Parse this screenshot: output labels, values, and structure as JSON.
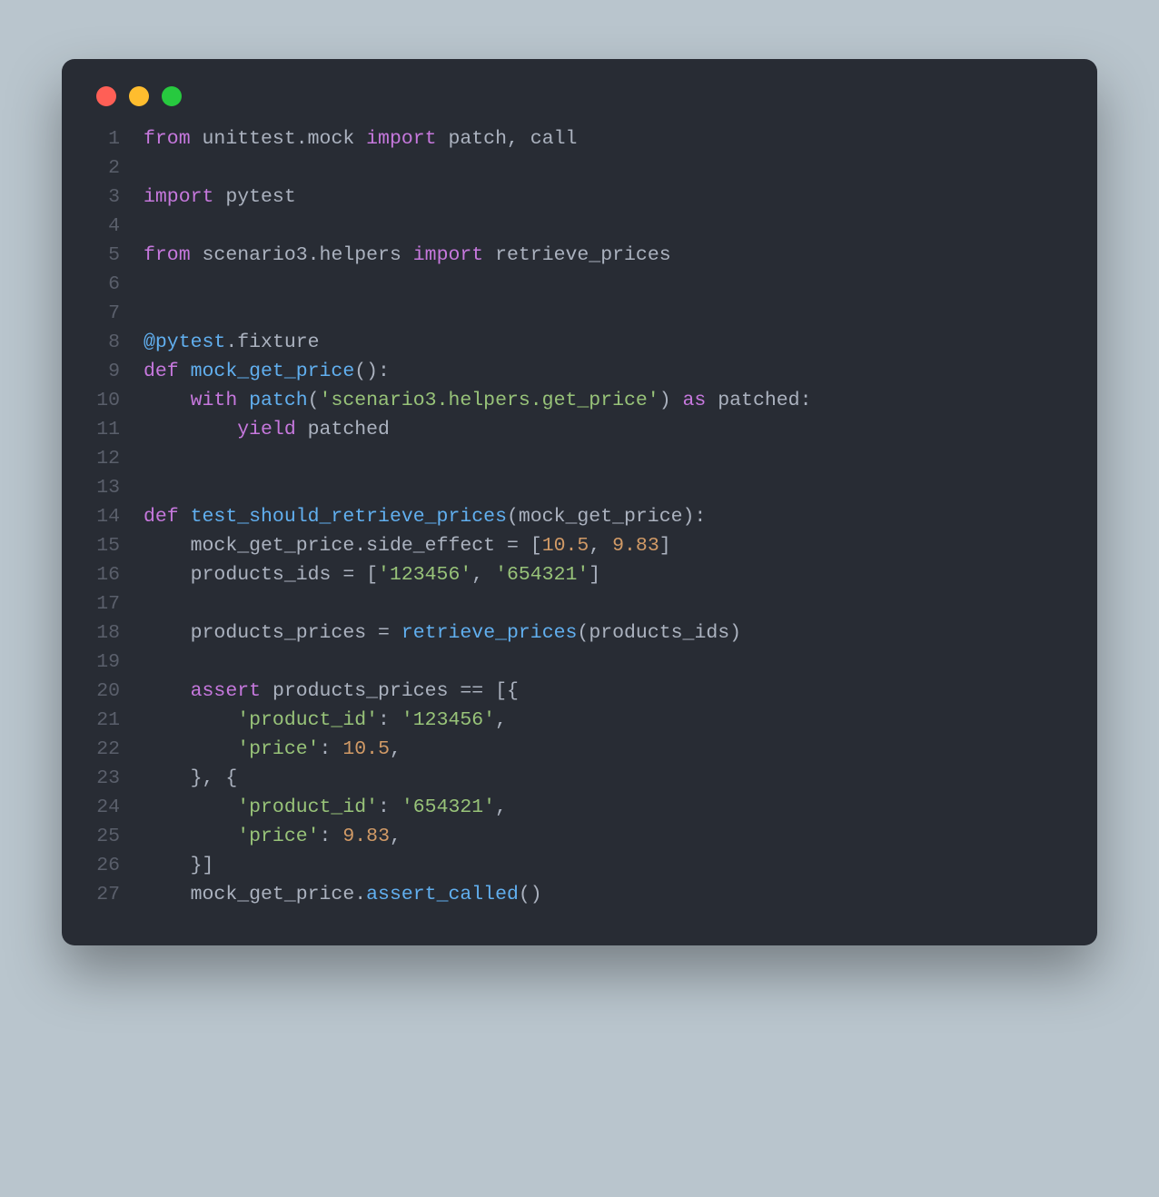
{
  "traffic_lights": [
    "close",
    "minimize",
    "zoom"
  ],
  "lines": [
    {
      "n": 1,
      "tokens": [
        {
          "t": "from ",
          "c": "tok-kw"
        },
        {
          "t": "unittest",
          "c": "tok-name"
        },
        {
          "t": ".",
          "c": "tok-op"
        },
        {
          "t": "mock",
          "c": "tok-name"
        },
        {
          "t": " import ",
          "c": "tok-kw"
        },
        {
          "t": "patch",
          "c": "tok-name"
        },
        {
          "t": ", ",
          "c": "tok-op"
        },
        {
          "t": "call",
          "c": "tok-name"
        }
      ]
    },
    {
      "n": 2,
      "tokens": []
    },
    {
      "n": 3,
      "tokens": [
        {
          "t": "import ",
          "c": "tok-kw"
        },
        {
          "t": "pytest",
          "c": "tok-name"
        }
      ]
    },
    {
      "n": 4,
      "tokens": []
    },
    {
      "n": 5,
      "tokens": [
        {
          "t": "from ",
          "c": "tok-kw"
        },
        {
          "t": "scenario3",
          "c": "tok-name"
        },
        {
          "t": ".",
          "c": "tok-op"
        },
        {
          "t": "helpers",
          "c": "tok-name"
        },
        {
          "t": " import ",
          "c": "tok-kw"
        },
        {
          "t": "retrieve_prices",
          "c": "tok-name"
        }
      ]
    },
    {
      "n": 6,
      "tokens": []
    },
    {
      "n": 7,
      "tokens": []
    },
    {
      "n": 8,
      "tokens": [
        {
          "t": "@pytest",
          "c": "tok-fn"
        },
        {
          "t": ".",
          "c": "tok-op"
        },
        {
          "t": "fixture",
          "c": "tok-name"
        }
      ]
    },
    {
      "n": 9,
      "tokens": [
        {
          "t": "def ",
          "c": "tok-kw"
        },
        {
          "t": "mock_get_price",
          "c": "tok-fn"
        },
        {
          "t": "():",
          "c": "tok-op"
        }
      ]
    },
    {
      "n": 10,
      "tokens": [
        {
          "t": "    ",
          "c": "tok-white"
        },
        {
          "t": "with ",
          "c": "tok-kw"
        },
        {
          "t": "patch",
          "c": "tok-fn"
        },
        {
          "t": "(",
          "c": "tok-op"
        },
        {
          "t": "'scenario3.helpers.get_price'",
          "c": "tok-str"
        },
        {
          "t": ")",
          "c": "tok-op"
        },
        {
          "t": " as ",
          "c": "tok-kw"
        },
        {
          "t": "patched",
          "c": "tok-name"
        },
        {
          "t": ":",
          "c": "tok-op"
        }
      ]
    },
    {
      "n": 11,
      "tokens": [
        {
          "t": "        ",
          "c": "tok-white"
        },
        {
          "t": "yield ",
          "c": "tok-kw"
        },
        {
          "t": "patched",
          "c": "tok-name"
        }
      ]
    },
    {
      "n": 12,
      "tokens": []
    },
    {
      "n": 13,
      "tokens": []
    },
    {
      "n": 14,
      "tokens": [
        {
          "t": "def ",
          "c": "tok-kw"
        },
        {
          "t": "test_should_retrieve_prices",
          "c": "tok-fn"
        },
        {
          "t": "(",
          "c": "tok-op"
        },
        {
          "t": "mock_get_price",
          "c": "tok-name"
        },
        {
          "t": "):",
          "c": "tok-op"
        }
      ]
    },
    {
      "n": 15,
      "tokens": [
        {
          "t": "    ",
          "c": "tok-white"
        },
        {
          "t": "mock_get_price",
          "c": "tok-name"
        },
        {
          "t": ".",
          "c": "tok-op"
        },
        {
          "t": "side_effect",
          "c": "tok-name"
        },
        {
          "t": " = [",
          "c": "tok-op"
        },
        {
          "t": "10.5",
          "c": "tok-num"
        },
        {
          "t": ", ",
          "c": "tok-op"
        },
        {
          "t": "9.83",
          "c": "tok-num"
        },
        {
          "t": "]",
          "c": "tok-op"
        }
      ]
    },
    {
      "n": 16,
      "tokens": [
        {
          "t": "    ",
          "c": "tok-white"
        },
        {
          "t": "products_ids",
          "c": "tok-name"
        },
        {
          "t": " = [",
          "c": "tok-op"
        },
        {
          "t": "'123456'",
          "c": "tok-str"
        },
        {
          "t": ", ",
          "c": "tok-op"
        },
        {
          "t": "'654321'",
          "c": "tok-str"
        },
        {
          "t": "]",
          "c": "tok-op"
        }
      ]
    },
    {
      "n": 17,
      "tokens": []
    },
    {
      "n": 18,
      "tokens": [
        {
          "t": "    ",
          "c": "tok-white"
        },
        {
          "t": "products_prices",
          "c": "tok-name"
        },
        {
          "t": " = ",
          "c": "tok-op"
        },
        {
          "t": "retrieve_prices",
          "c": "tok-fn"
        },
        {
          "t": "(",
          "c": "tok-op"
        },
        {
          "t": "products_ids",
          "c": "tok-name"
        },
        {
          "t": ")",
          "c": "tok-op"
        }
      ]
    },
    {
      "n": 19,
      "tokens": []
    },
    {
      "n": 20,
      "tokens": [
        {
          "t": "    ",
          "c": "tok-white"
        },
        {
          "t": "assert ",
          "c": "tok-kw"
        },
        {
          "t": "products_prices",
          "c": "tok-name"
        },
        {
          "t": " == [{",
          "c": "tok-op"
        }
      ]
    },
    {
      "n": 21,
      "tokens": [
        {
          "t": "        ",
          "c": "tok-white"
        },
        {
          "t": "'product_id'",
          "c": "tok-str"
        },
        {
          "t": ": ",
          "c": "tok-op"
        },
        {
          "t": "'123456'",
          "c": "tok-str"
        },
        {
          "t": ",",
          "c": "tok-op"
        }
      ]
    },
    {
      "n": 22,
      "tokens": [
        {
          "t": "        ",
          "c": "tok-white"
        },
        {
          "t": "'price'",
          "c": "tok-str"
        },
        {
          "t": ": ",
          "c": "tok-op"
        },
        {
          "t": "10.5",
          "c": "tok-num"
        },
        {
          "t": ",",
          "c": "tok-op"
        }
      ]
    },
    {
      "n": 23,
      "tokens": [
        {
          "t": "    ",
          "c": "tok-white"
        },
        {
          "t": "}, {",
          "c": "tok-op"
        }
      ]
    },
    {
      "n": 24,
      "tokens": [
        {
          "t": "        ",
          "c": "tok-white"
        },
        {
          "t": "'product_id'",
          "c": "tok-str"
        },
        {
          "t": ": ",
          "c": "tok-op"
        },
        {
          "t": "'654321'",
          "c": "tok-str"
        },
        {
          "t": ",",
          "c": "tok-op"
        }
      ]
    },
    {
      "n": 25,
      "tokens": [
        {
          "t": "        ",
          "c": "tok-white"
        },
        {
          "t": "'price'",
          "c": "tok-str"
        },
        {
          "t": ": ",
          "c": "tok-op"
        },
        {
          "t": "9.83",
          "c": "tok-num"
        },
        {
          "t": ",",
          "c": "tok-op"
        }
      ]
    },
    {
      "n": 26,
      "tokens": [
        {
          "t": "    ",
          "c": "tok-white"
        },
        {
          "t": "}]",
          "c": "tok-op"
        }
      ]
    },
    {
      "n": 27,
      "tokens": [
        {
          "t": "    ",
          "c": "tok-white"
        },
        {
          "t": "mock_get_price",
          "c": "tok-name"
        },
        {
          "t": ".",
          "c": "tok-op"
        },
        {
          "t": "assert_called",
          "c": "tok-fn"
        },
        {
          "t": "()",
          "c": "tok-op"
        }
      ]
    }
  ]
}
